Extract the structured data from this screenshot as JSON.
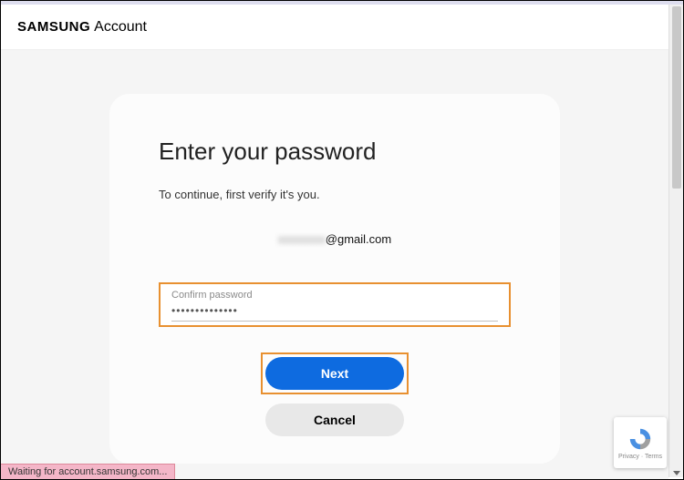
{
  "header": {
    "brand": "SAMSUNG",
    "product": "Account"
  },
  "card": {
    "title": "Enter your password",
    "subtitle": "To continue, first verify it's you.",
    "email_hidden_part": "xxxxxxxx",
    "email_visible_part": "@gmail.com",
    "password_label": "Confirm password",
    "password_value": "••••••••••••••",
    "next_label": "Next",
    "cancel_label": "Cancel"
  },
  "status": "Waiting for account.samsung.com...",
  "recaptcha_footer": "Privacy · Terms"
}
